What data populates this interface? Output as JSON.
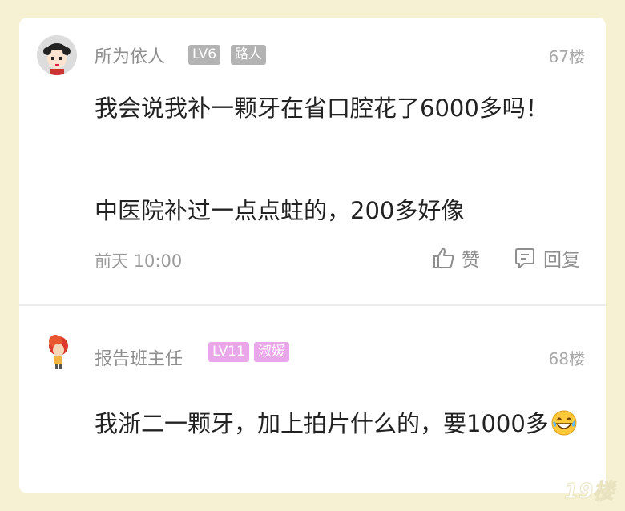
{
  "posts": [
    {
      "username": "所为依人",
      "level": "LV6",
      "role": "路人",
      "floor": "67楼",
      "paragraphs": [
        "我会说我补一颗牙在省口腔花了6000多吗！",
        "中医院补过一点点蛀的，200多好像"
      ],
      "time": "前天 10:00",
      "like_label": "赞",
      "reply_label": "回复",
      "badge_color": "#b3b3b3"
    },
    {
      "username": "报告班主任",
      "level": "LV11",
      "role": "淑媛",
      "floor": "68楼",
      "paragraphs": [
        "我浙二一颗牙，加上拍片什么的，要1000多"
      ],
      "emoji": "grinning-sweat-emoji",
      "badge_color": "#e9a6e9"
    }
  ],
  "watermark": "19楼",
  "colors": {
    "background": "#f6f1d2",
    "card": "#ffffff",
    "muted_text": "#8e8e8e",
    "body_text": "#222222"
  }
}
